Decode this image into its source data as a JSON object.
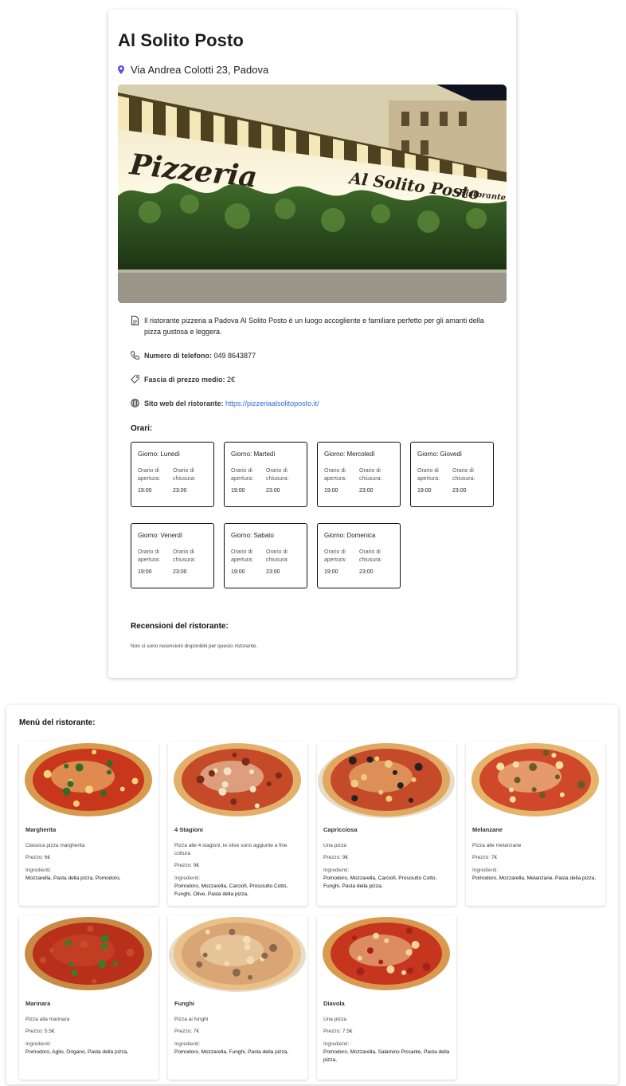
{
  "restaurant": {
    "name": "Al Solito Posto",
    "address": "Via Andrea Colotti 23, Padova",
    "hero_sign_main": "Pizzeria",
    "hero_sign_name": "Al Solito Posto",
    "hero_sign_sub": "Ristorante",
    "description": "Il ristorante pizzeria a Padova Al Solito Posto è un luogo accogliente e familiare perfetto per gli amanti della pizza gustosa e leggera.",
    "phone_label": "Numero di telefono:",
    "phone": "049 8643877",
    "price_label": "Fascia di prezzo medio:",
    "price": "2€",
    "website_label": "Sito web del ristorante:",
    "website": "https://pizzeriaalsolitoposto.it/"
  },
  "hours": {
    "title": "Orari:",
    "open_label_1": "Orario di",
    "open_label_2": "apertura:",
    "close_label_1": "Orario di",
    "close_label_2": "chiusura:",
    "days": [
      {
        "day": "Giorno: Lunedì",
        "open": "19:00",
        "close": "23:00"
      },
      {
        "day": "Giorno: Martedì",
        "open": "19:00",
        "close": "23:00"
      },
      {
        "day": "Giorno: Mercoledì",
        "open": "19:00",
        "close": "23:00"
      },
      {
        "day": "Giorno: Giovedì",
        "open": "19:00",
        "close": "23:00"
      },
      {
        "day": "Giorno: Venerdì",
        "open": "19:00",
        "close": "23:00"
      },
      {
        "day": "Giorno: Sabato",
        "open": "19:00",
        "close": "23:00"
      },
      {
        "day": "Giorno: Domenica",
        "open": "19:00",
        "close": "23:00"
      }
    ]
  },
  "reviews": {
    "title": "Recensioni del ristorante:",
    "empty": "Non ci sono recensioni disponibili per questo ristorante."
  },
  "menu": {
    "title": "Menù del ristorante:",
    "ingredients_label": "Ingredienti:",
    "items": [
      {
        "name": "Margherita",
        "desc": "Classica pizza margherita",
        "price": "Prezzo: 6€",
        "ingredients": "Mozzarella, Pasta della pizza, Pomodoro,"
      },
      {
        "name": "4 Stagioni",
        "desc": "Pizza alle 4 stagioni, le olive sono aggiunte a fine cottura",
        "price": "Prezzo: 9€",
        "ingredients": "Pomodoro, Mozzarella, Carciofi, Prosciutto Cotto, Funghi, Olive, Pasta della pizza,"
      },
      {
        "name": "Capricciosa",
        "desc": "Una pizza",
        "price": "Prezzo: 9€",
        "ingredients": "Pomodoro, Mozzarella, Carciofi, Prosciutto Cotto, Funghi, Pasta della pizza,"
      },
      {
        "name": "Melanzane",
        "desc": "Pizza alle melanzane",
        "price": "Prezzo: 7€",
        "ingredients": "Pomodoro, Mozzarella, Melanzane, Pasta della pizza,"
      },
      {
        "name": "Marinara",
        "desc": "Pizza alla marinara",
        "price": "Prezzo: 5.5€",
        "ingredients": "Pomodoro, Aglio, Origano, Pasta della pizza,"
      },
      {
        "name": "Funghi",
        "desc": "Pizza ai funghi",
        "price": "Prezzo: 7€",
        "ingredients": "Pomodoro, Mozzarella, Funghi, Pasta della pizza,"
      },
      {
        "name": "Diavola",
        "desc": "Una pizza",
        "price": "Prezzo: 7.5€",
        "ingredients": "Pomodoro, Mozzarella, Salamino Piccante, Pasta della pizza,"
      }
    ]
  },
  "colors": {
    "accent_link": "#2a6bd8",
    "pin": "#5b4fd6"
  }
}
